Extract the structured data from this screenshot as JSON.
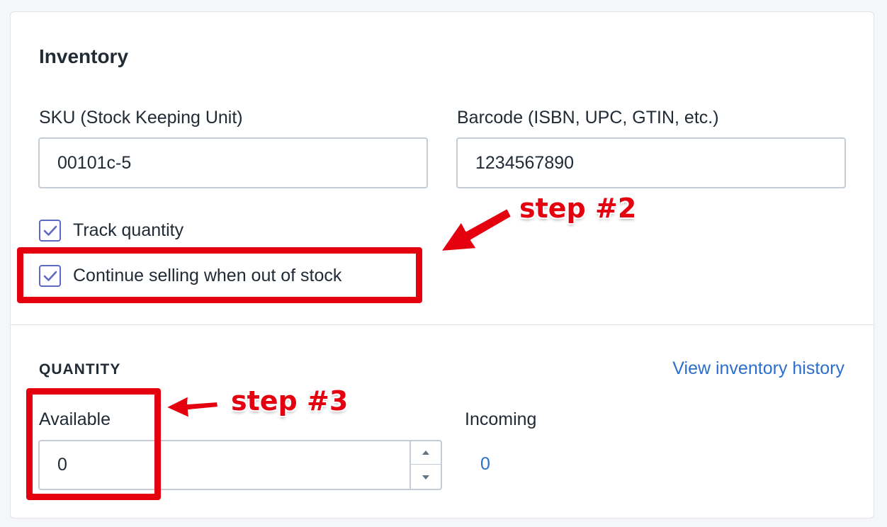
{
  "inventory": {
    "title": "Inventory",
    "sku": {
      "label": "SKU (Stock Keeping Unit)",
      "value": "00101c-5"
    },
    "barcode": {
      "label": "Barcode (ISBN, UPC, GTIN, etc.)",
      "value": "1234567890"
    },
    "track_quantity": {
      "label": "Track quantity",
      "checked": true
    },
    "continue_selling": {
      "label": "Continue selling when out of stock",
      "checked": true
    }
  },
  "quantity": {
    "heading": "QUANTITY",
    "history_link": "View inventory history",
    "available": {
      "label": "Available",
      "value": "0"
    },
    "incoming": {
      "label": "Incoming",
      "value": "0"
    }
  },
  "annotations": {
    "step2": "step #2",
    "step3": "step #3",
    "color": "#e4000f"
  },
  "colors": {
    "checkbox": "#5c6ac4",
    "link": "#2c6ecb",
    "text": "#212b36",
    "border": "#c4cdd5"
  }
}
